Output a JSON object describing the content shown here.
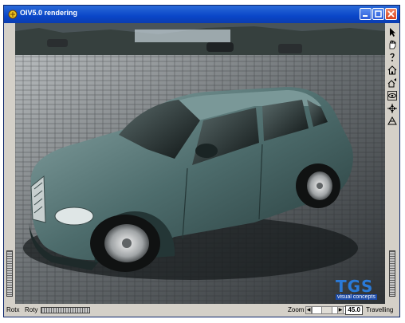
{
  "window": {
    "title": "OIV5.0 rendering"
  },
  "titlebar_buttons": [
    {
      "name": "minimize-button",
      "icon": "minimize-icon"
    },
    {
      "name": "maximize-button",
      "icon": "maximize-icon"
    },
    {
      "name": "close-button",
      "icon": "close-icon"
    }
  ],
  "toolbar": {
    "tools": [
      {
        "name": "select-arrow-tool",
        "icon": "arrow-cursor-icon"
      },
      {
        "name": "view-hand-tool",
        "icon": "hand-icon"
      },
      {
        "name": "seek-tool",
        "icon": "seek-question-icon"
      },
      {
        "name": "home-tool",
        "icon": "home-icon"
      },
      {
        "name": "set-home-tool",
        "icon": "set-home-icon"
      },
      {
        "name": "view-all-tool",
        "icon": "view-all-eye-icon"
      },
      {
        "name": "seek-target-tool",
        "icon": "crosshair-icon"
      },
      {
        "name": "perspective-tool",
        "icon": "perspective-icon"
      }
    ]
  },
  "statusbar": {
    "rotx_label": "Rotx",
    "roty_label": "Roty",
    "zoom_label": "Zoom",
    "zoom_value": "45.0",
    "mode_label": "Travelling"
  },
  "logo": {
    "big": "TGS",
    "small": "visual concepts"
  },
  "colors": {
    "titlebar": "#0a46c8",
    "frame": "#d4d0c8",
    "car_body": "#4a6a6a"
  }
}
